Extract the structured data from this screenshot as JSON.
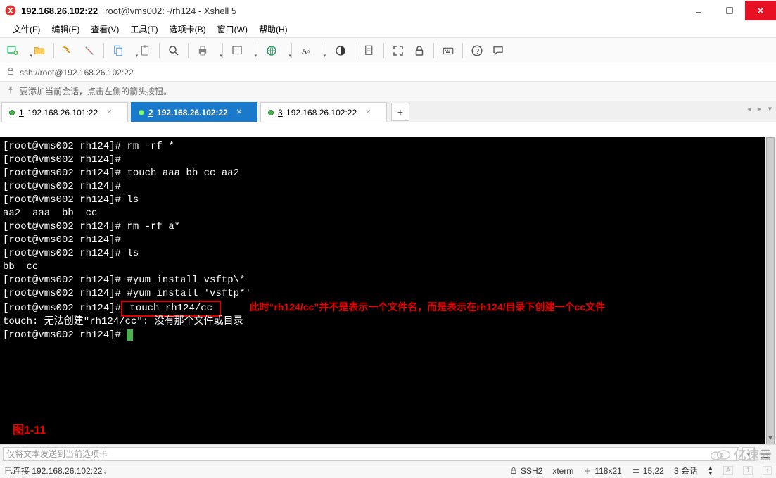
{
  "window": {
    "title": "192.168.26.102:22",
    "subtitle": "root@vms002:~/rh124 - Xshell 5"
  },
  "menu": {
    "file": "文件(F)",
    "edit": "编辑(E)",
    "view": "查看(V)",
    "tools": "工具(T)",
    "tabs": "选项卡(B)",
    "window": "窗口(W)",
    "help": "帮助(H)"
  },
  "address": {
    "url": "ssh://root@192.168.26.102:22"
  },
  "hint": {
    "text": "要添加当前会话，点击左侧的箭头按钮。"
  },
  "tabstrip": {
    "items": [
      {
        "num": "1",
        "label": "192.168.26.101:22",
        "active": false
      },
      {
        "num": "2",
        "label": "192.168.26.102:22",
        "active": true
      },
      {
        "num": "3",
        "label": "192.168.26.102:22",
        "active": false
      }
    ]
  },
  "terminal": {
    "lines": [
      "[root@vms002 rh124]# rm -rf *",
      "[root@vms002 rh124]#",
      "[root@vms002 rh124]# touch aaa bb cc aa2",
      "[root@vms002 rh124]#",
      "[root@vms002 rh124]# ls",
      "aa2  aaa  bb  cc",
      "[root@vms002 rh124]# rm -rf a*",
      "[root@vms002 rh124]#",
      "[root@vms002 rh124]# ls",
      "bb  cc",
      "[root@vms002 rh124]# #yum install vsftp\\*",
      "[root@vms002 rh124]# #yum install 'vsftp*'"
    ],
    "hl_prefix": "[root@vms002 rh124]#",
    "hl_cmd": " touch rh124/cc ",
    "annotation": "此时“rh124/cc”并不是表示一个文件名，而是表示在rh124/目录下创建一个cc文件",
    "after_hl": "touch: 无法创建\"rh124/cc\": 没有那个文件或目录",
    "final_prompt": "[root@vms002 rh124]# ",
    "figure_label": "图1-11"
  },
  "inputbar": {
    "placeholder": "仅将文本发送到当前选项卡"
  },
  "status": {
    "connected": "已连接 192.168.26.102:22。",
    "proto": "SSH2",
    "term": "xterm",
    "size": "118x21",
    "pos": "15,22",
    "sessions": "3 会话"
  },
  "watermark": {
    "text": "亿速云"
  },
  "icons": {
    "app": "xshell-icon",
    "lock": "lock-icon",
    "pin": "pin-icon"
  }
}
